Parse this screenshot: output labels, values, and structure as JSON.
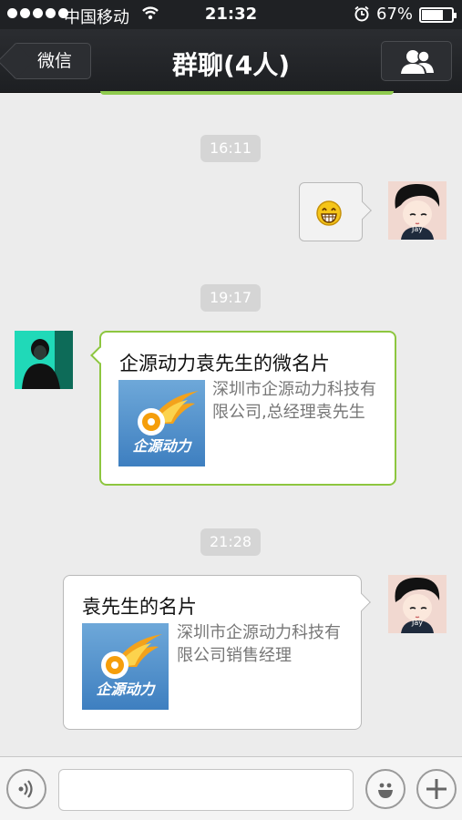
{
  "status_bar": {
    "carrier": "中国移动",
    "time": "21:32",
    "battery_percent": "67%",
    "battery_level": 0.67
  },
  "nav": {
    "back_label": "微信",
    "title": "群聊(4人)"
  },
  "messages": {
    "ts1": "16:11",
    "ts2": "19:17",
    "ts3": "21:28",
    "avatar_label": "Jay",
    "received_card": {
      "title": "企源动力袁先生的微名片",
      "logo_text": "企源动力",
      "description": "深圳市企源动力科技有限公司,总经理袁先生"
    },
    "sent_card": {
      "title": "袁先生的名片",
      "logo_text": "企源动力",
      "description": "深圳市企源动力科技有限公司销售经理"
    }
  },
  "colors": {
    "nav_bg": "#1f2124",
    "received_border": "#8dc63f",
    "timestamp_bg": "#d5d5d5",
    "logo_blue": "#4a8bc9"
  }
}
